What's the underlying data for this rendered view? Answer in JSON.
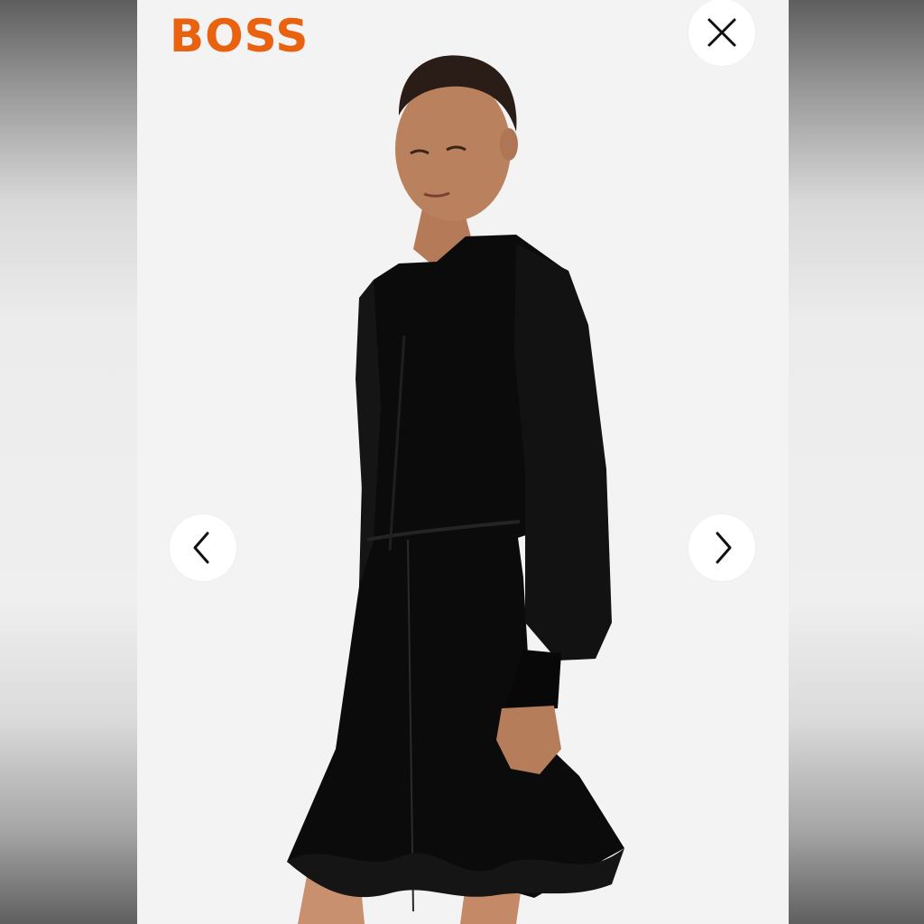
{
  "brand": {
    "name": "BOSS",
    "color": "#e8620f"
  },
  "viewer": {
    "close_icon": "close-icon",
    "prev_icon": "chevron-left-icon",
    "next_icon": "chevron-right-icon",
    "image_subject": "product-photo"
  },
  "colors": {
    "viewer_background": "#f3f3f3",
    "side_background": "#e9e9e9",
    "button_background": "#ffffff",
    "icon_color": "#111111"
  }
}
